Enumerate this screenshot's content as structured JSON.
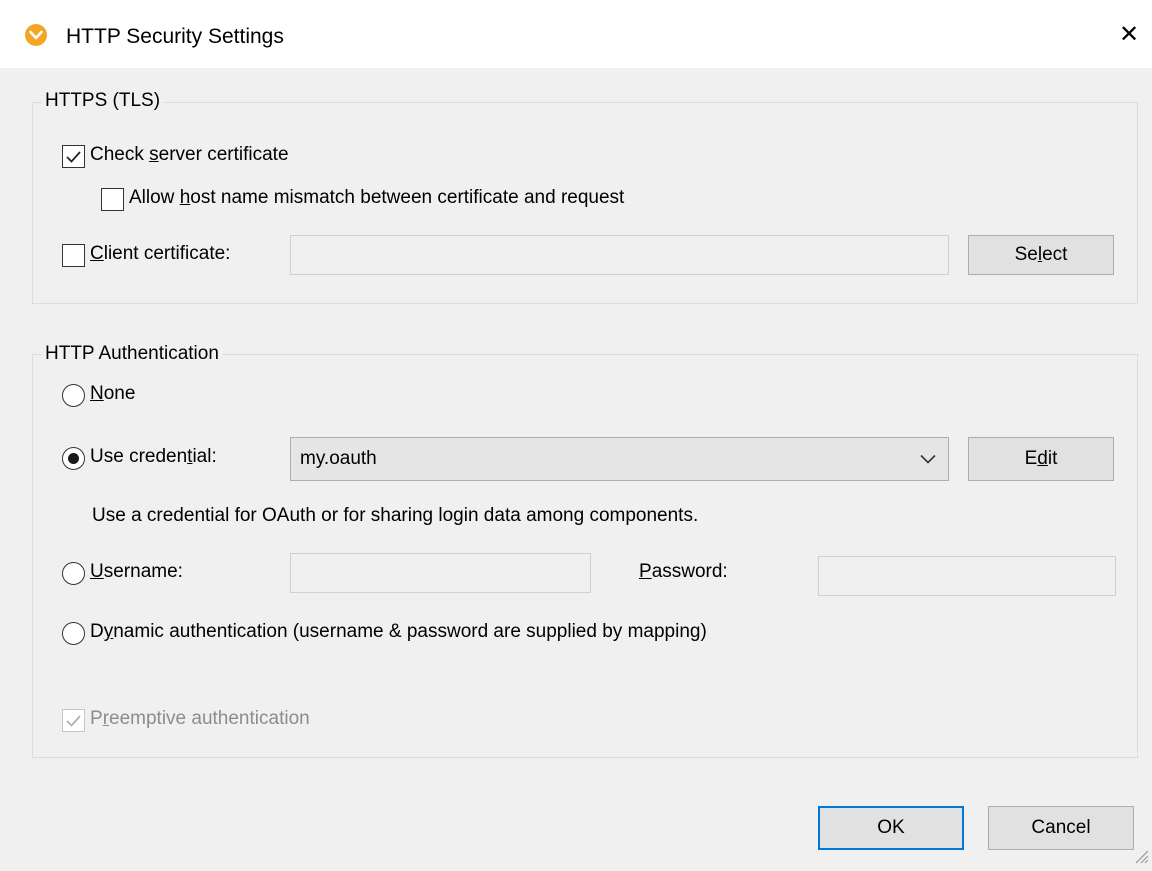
{
  "window": {
    "title": "HTTP Security Settings",
    "close_glyph": "✕",
    "icon": "altova-mapforce-app-icon",
    "accent_color": "#f5a524"
  },
  "https_group": {
    "legend": "HTTPS (TLS)",
    "check_server_certificate": {
      "label_prefix": "Check ",
      "label_mnemonic": "s",
      "label_suffix": "erver certificate",
      "checked": true
    },
    "allow_host_mismatch": {
      "label_prefix": "Allow ",
      "label_mnemonic": "h",
      "label_suffix": "ost name mismatch between certificate and request",
      "checked": false
    },
    "client_certificate": {
      "label_prefix": "",
      "label_mnemonic": "C",
      "label_suffix": "lient certificate:",
      "checked": false,
      "value": ""
    },
    "select_button": {
      "prefix": "Se",
      "mnemonic": "l",
      "suffix": "ect"
    }
  },
  "auth_group": {
    "legend": "HTTP Authentication",
    "none": {
      "prefix": "",
      "mnemonic": "N",
      "suffix": "one",
      "selected": false
    },
    "use_credential": {
      "prefix": "Use creden",
      "mnemonic": "t",
      "suffix": "ial:",
      "selected": true,
      "value": "my.oauth"
    },
    "edit_button": {
      "prefix": "E",
      "mnemonic": "d",
      "suffix": "it"
    },
    "credential_hint": "Use a credential for OAuth or for sharing login data among components.",
    "username": {
      "prefix": "",
      "mnemonic": "U",
      "suffix": "sername:",
      "selected": false,
      "value": ""
    },
    "password": {
      "prefix": "",
      "mnemonic": "P",
      "suffix": "assword:",
      "value": ""
    },
    "dynamic": {
      "prefix": "D",
      "mnemonic": "y",
      "suffix": "namic authentication (username & password are supplied by mapping)",
      "selected": false
    },
    "preemptive": {
      "prefix": "P",
      "mnemonic": "r",
      "suffix": "eemptive authentication",
      "checked": true,
      "enabled": false
    }
  },
  "footer": {
    "ok_label": "OK",
    "cancel_label": "Cancel"
  }
}
